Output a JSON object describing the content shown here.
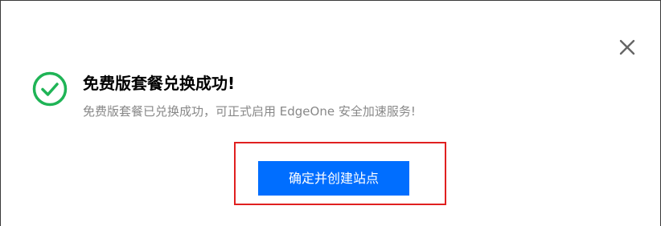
{
  "dialog": {
    "title": "免费版套餐兑换成功!",
    "description": "免费版套餐已兑换成功，可正式启用 EdgeOne 安全加速服务!",
    "confirm_button_label": "确定并创建站点"
  },
  "icons": {
    "status": "check-circle-icon",
    "close": "close-icon"
  },
  "colors": {
    "success": "#1fb456",
    "primary": "#006eff",
    "highlight": "#e02020"
  }
}
